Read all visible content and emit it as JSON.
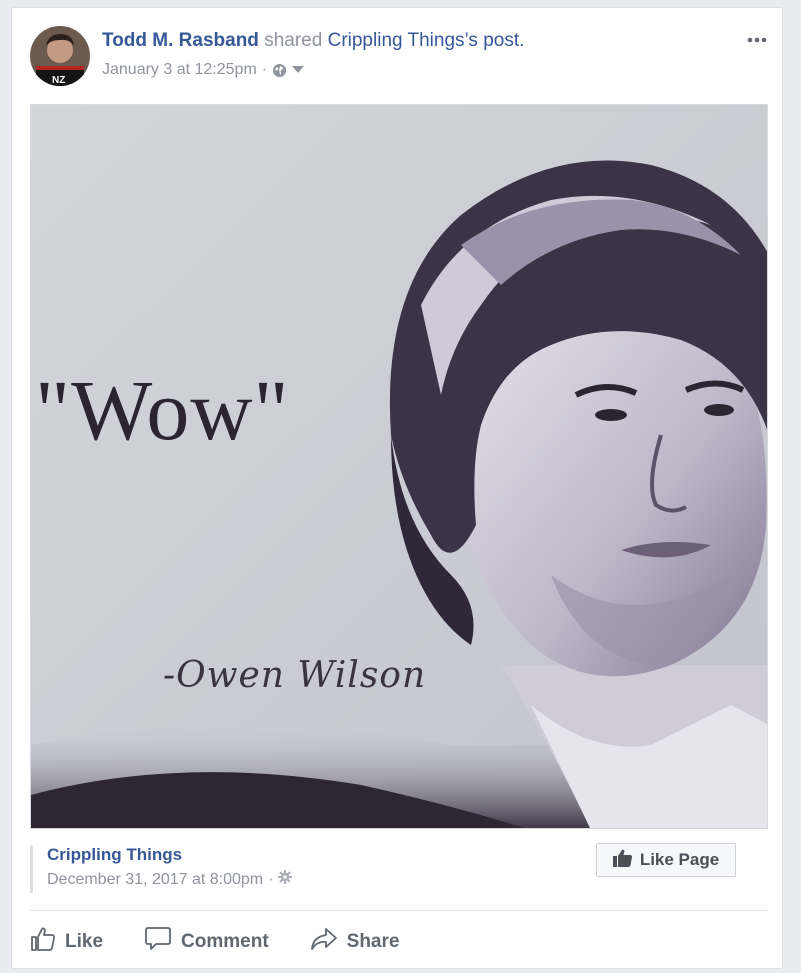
{
  "post": {
    "author_name": "Todd M. Rasband",
    "shared_word": "shared",
    "source_possessive": "Crippling Things",
    "source_suffix": "’s post.",
    "timestamp": "January 3 at 12:25pm",
    "separator": "·",
    "privacy_icon": "globe-icon",
    "audience_caret": "caret-down-icon",
    "more_icon": "ellipsis-icon"
  },
  "image": {
    "quote_text": "\"Wow\"",
    "attribution_text": "-Owen Wilson"
  },
  "shared_from": {
    "page_name": "Crippling Things",
    "timestamp": "December 31, 2017 at 8:00pm",
    "separator": "·",
    "privacy_icon": "gear-icon",
    "like_page_label": "Like Page"
  },
  "actions": {
    "like": "Like",
    "comment": "Comment",
    "share": "Share"
  },
  "colors": {
    "link": "#365899",
    "meta": "#90949c",
    "action_text": "#606770",
    "background": "#e9ebee"
  }
}
